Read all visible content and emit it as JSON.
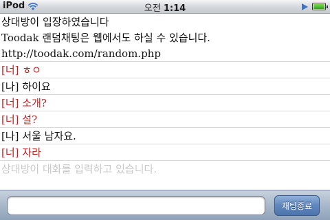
{
  "status_bar": {
    "device": "iPod",
    "time_ampm": "오전",
    "time_clock": "1:14",
    "icons": [
      "wifi-icon",
      "play-icon",
      "battery-icon"
    ]
  },
  "chat": {
    "system_lines": [
      "상대방이 입장하였습니다",
      "Toodak 랜덤채팅은 웹에서도 하실 수 있습니다.",
      "http://toodak.com/random.php"
    ],
    "messages": [
      {
        "speaker": "[너]",
        "text": " ㅎㅇ",
        "from": "them"
      },
      {
        "speaker": "[나]",
        "text": " 하이요",
        "from": "me"
      },
      {
        "speaker": "[너]",
        "text": " 소개?",
        "from": "them"
      },
      {
        "speaker": "[너]",
        "text": " 설?",
        "from": "them"
      },
      {
        "speaker": "[나]",
        "text": " 서울 남자요.",
        "from": "me"
      },
      {
        "speaker": "[너]",
        "text": " 자라",
        "from": "them"
      }
    ],
    "typing_indicator": "상대방이 대화를 입력하고 있습니다."
  },
  "input_bar": {
    "input_value": "",
    "input_placeholder": "",
    "end_button_label": "채팅종료"
  },
  "colors": {
    "them": "#c21f1f",
    "me": "#111111",
    "typing": "#c9c9c9",
    "button": "#5f86bd"
  }
}
